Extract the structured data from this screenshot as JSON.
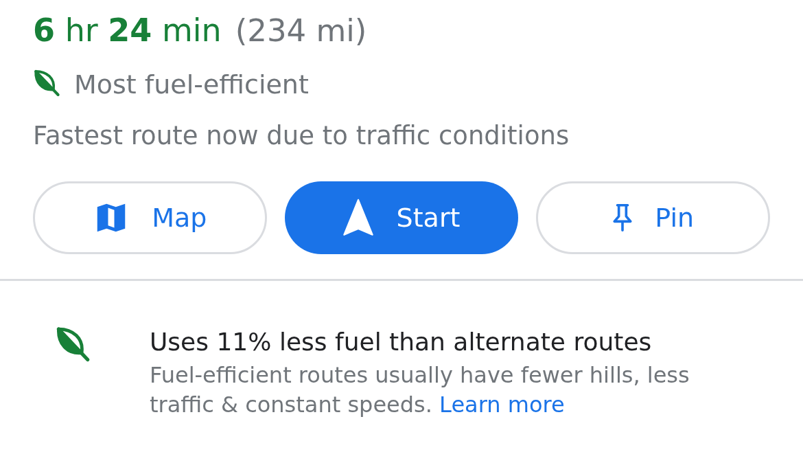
{
  "summary": {
    "duration": "**6** hr **24** min",
    "distance": "(234 mi)",
    "badge": {
      "label": "Most fuel-efficient"
    },
    "note": "Fastest route now due to traffic conditions"
  },
  "actions": [
    {
      "kind": "map",
      "label": "Map",
      "primary": false
    },
    {
      "kind": "start",
      "label": "Start",
      "primary": true
    },
    {
      "kind": "pin",
      "label": "Pin",
      "primary": false
    }
  ],
  "fuel_info": {
    "title": "Uses 11% less fuel than alternate routes",
    "description": "Fuel-efficient routes usually have fewer hills, less traffic & constant speeds.",
    "link": "Learn more"
  }
}
